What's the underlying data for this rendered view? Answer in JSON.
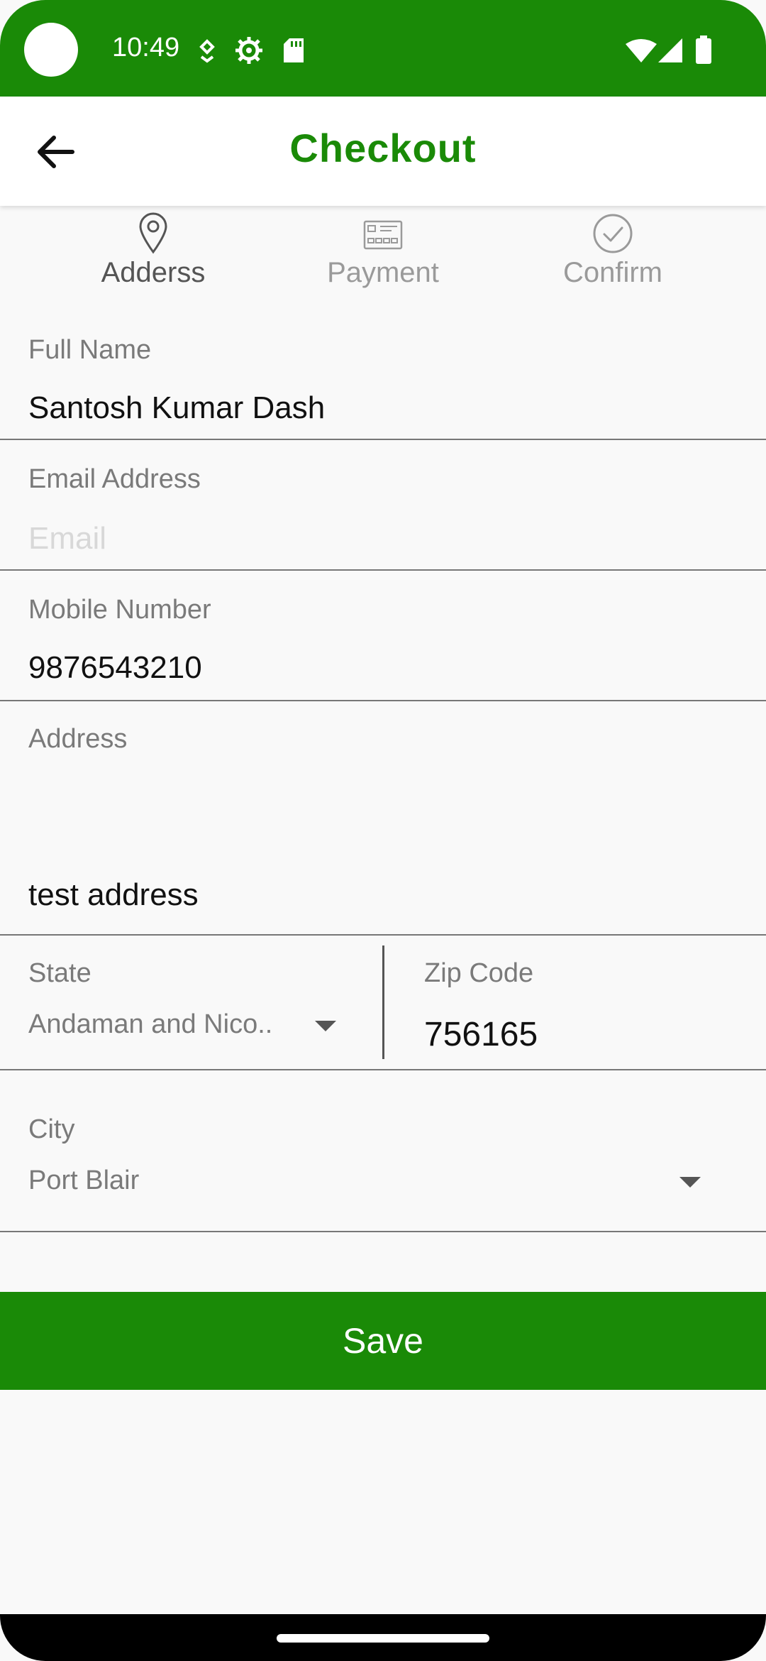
{
  "status_bar": {
    "time": "10:49",
    "icons": [
      "camera-cutout",
      "assistant-icon",
      "settings-icon",
      "sd-card-icon",
      "wifi-icon",
      "signal-icon",
      "battery-icon"
    ]
  },
  "app_bar": {
    "title": "Checkout",
    "back_icon": "arrow-left-icon"
  },
  "stepper": {
    "steps": [
      {
        "label": "Adderss",
        "icon": "location-pin-icon",
        "active": true
      },
      {
        "label": "Payment",
        "icon": "credit-card-icon",
        "active": false
      },
      {
        "label": "Confirm",
        "icon": "check-circle-icon",
        "active": false
      }
    ]
  },
  "form": {
    "full_name": {
      "label": "Full Name",
      "value": "Santosh Kumar Dash"
    },
    "email": {
      "label": "Email Address",
      "value": "",
      "placeholder": "Email"
    },
    "mobile": {
      "label": "Mobile Number",
      "value": "9876543210"
    },
    "address": {
      "label": "Address",
      "value": "test address"
    },
    "state": {
      "label": "State",
      "value": "Andaman and Nico.."
    },
    "zip": {
      "label": "Zip Code",
      "value": "756165"
    },
    "city": {
      "label": "City",
      "value": "Port Blair"
    }
  },
  "save_button": {
    "label": "Save"
  },
  "colors": {
    "brand": "#1a8a07",
    "background": "#f9f9f9"
  }
}
